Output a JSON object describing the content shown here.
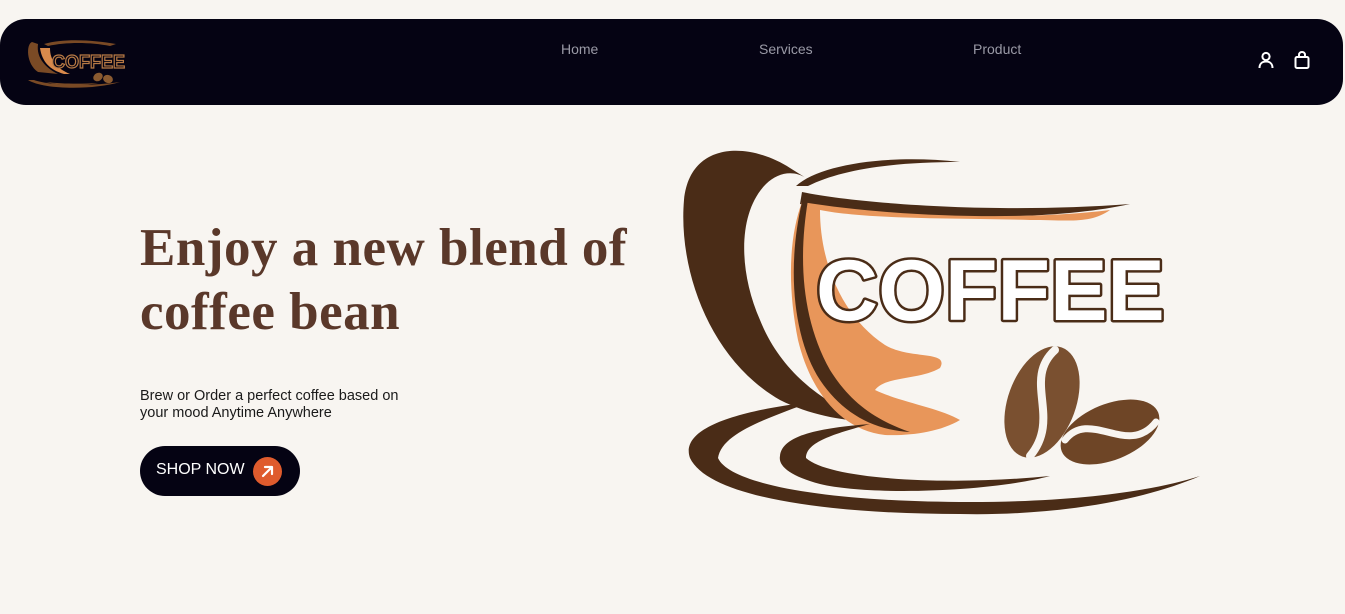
{
  "header": {
    "logo_text": "COFFEE",
    "nav": {
      "home": "Home",
      "services": "Services",
      "product": "Product"
    },
    "icons": {
      "account": "user-icon",
      "cart": "shopping-bag-icon"
    }
  },
  "hero": {
    "title": "Enjoy a new blend of coffee bean",
    "subtitle": "Brew or Order a perfect coffee based on your mood Anytime Anywhere",
    "cta_label": "SHOP NOW",
    "cta_icon": "arrow-up-right-icon",
    "illustration_text": "COFFEE"
  },
  "colors": {
    "nav_background": "#050313",
    "page_background": "#f8f5f1",
    "title_brown": "#5a382a",
    "accent_orange": "#df5b2d",
    "cup_dark_brown": "#4a2c17",
    "cup_light_orange": "#e8965a",
    "bean_brown": "#7a5030"
  }
}
